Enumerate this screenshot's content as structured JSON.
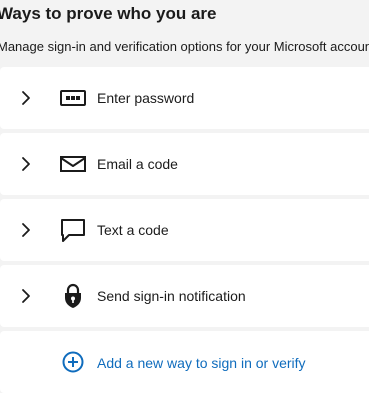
{
  "section": {
    "title": "Ways to prove who you are",
    "subtitle": "Manage sign-in and verification options for your Microsoft account."
  },
  "methods": [
    {
      "label": "Enter password",
      "icon": "password-dots-icon"
    },
    {
      "label": "Email a code",
      "icon": "envelope-icon"
    },
    {
      "label": "Text a code",
      "icon": "chat-bubble-icon"
    },
    {
      "label": "Send sign-in notification",
      "icon": "lock-shield-icon"
    }
  ],
  "add_method": {
    "label": "Add a new way to sign in or verify",
    "icon": "add-circle-icon"
  },
  "colors": {
    "background": "#f3f3f3",
    "card": "#ffffff",
    "text": "#1b1b1b",
    "link": "#0f6cbd"
  }
}
